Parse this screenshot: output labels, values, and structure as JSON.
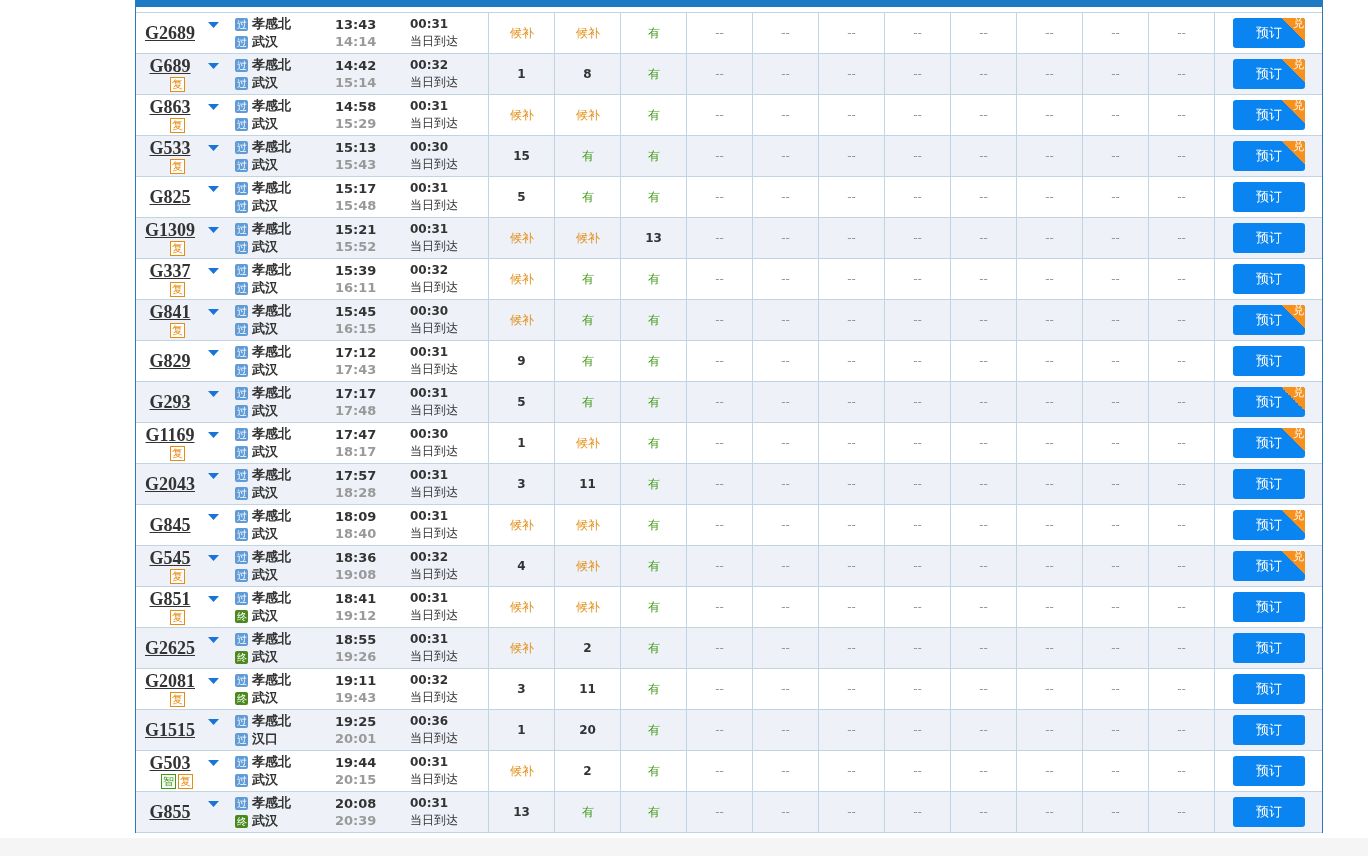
{
  "rows": [
    {
      "train": "G2689",
      "tags": [],
      "from": {
        "mark": "过",
        "kind": "pass",
        "name": "孝感北"
      },
      "to": {
        "mark": "过",
        "kind": "pass",
        "name": "武汉"
      },
      "depart": "13:43",
      "arrive": "14:14",
      "duration": "00:31",
      "arrival_note": "当日到达",
      "seats": [
        {
          "text": "候补",
          "kind": "wait"
        },
        {
          "text": "候补",
          "kind": "wait"
        },
        {
          "text": "有",
          "kind": "avail"
        }
      ],
      "other_seats": [
        "--",
        "--",
        "--",
        "--",
        "--",
        "--",
        "--",
        "--"
      ],
      "button": "预订",
      "badge": "兑"
    },
    {
      "train": "G689",
      "tags": [
        {
          "text": "复",
          "kind": "orange"
        }
      ],
      "from": {
        "mark": "过",
        "kind": "pass",
        "name": "孝感北"
      },
      "to": {
        "mark": "过",
        "kind": "pass",
        "name": "武汉"
      },
      "depart": "14:42",
      "arrive": "15:14",
      "duration": "00:32",
      "arrival_note": "当日到达",
      "seats": [
        {
          "text": "1",
          "kind": "count"
        },
        {
          "text": "8",
          "kind": "count"
        },
        {
          "text": "有",
          "kind": "avail"
        }
      ],
      "other_seats": [
        "--",
        "--",
        "--",
        "--",
        "--",
        "--",
        "--",
        "--"
      ],
      "button": "预订",
      "badge": "兑"
    },
    {
      "train": "G863",
      "tags": [
        {
          "text": "复",
          "kind": "orange"
        }
      ],
      "from": {
        "mark": "过",
        "kind": "pass",
        "name": "孝感北"
      },
      "to": {
        "mark": "过",
        "kind": "pass",
        "name": "武汉"
      },
      "depart": "14:58",
      "arrive": "15:29",
      "duration": "00:31",
      "arrival_note": "当日到达",
      "seats": [
        {
          "text": "候补",
          "kind": "wait"
        },
        {
          "text": "候补",
          "kind": "wait"
        },
        {
          "text": "有",
          "kind": "avail"
        }
      ],
      "other_seats": [
        "--",
        "--",
        "--",
        "--",
        "--",
        "--",
        "--",
        "--"
      ],
      "button": "预订",
      "badge": "兑"
    },
    {
      "train": "G533",
      "tags": [
        {
          "text": "复",
          "kind": "orange"
        }
      ],
      "from": {
        "mark": "过",
        "kind": "pass",
        "name": "孝感北"
      },
      "to": {
        "mark": "过",
        "kind": "pass",
        "name": "武汉"
      },
      "depart": "15:13",
      "arrive": "15:43",
      "duration": "00:30",
      "arrival_note": "当日到达",
      "seats": [
        {
          "text": "15",
          "kind": "count"
        },
        {
          "text": "有",
          "kind": "avail"
        },
        {
          "text": "有",
          "kind": "avail"
        }
      ],
      "other_seats": [
        "--",
        "--",
        "--",
        "--",
        "--",
        "--",
        "--",
        "--"
      ],
      "button": "预订",
      "badge": "兑"
    },
    {
      "train": "G825",
      "tags": [],
      "from": {
        "mark": "过",
        "kind": "pass",
        "name": "孝感北"
      },
      "to": {
        "mark": "过",
        "kind": "pass",
        "name": "武汉"
      },
      "depart": "15:17",
      "arrive": "15:48",
      "duration": "00:31",
      "arrival_note": "当日到达",
      "seats": [
        {
          "text": "5",
          "kind": "count"
        },
        {
          "text": "有",
          "kind": "avail"
        },
        {
          "text": "有",
          "kind": "avail"
        }
      ],
      "other_seats": [
        "--",
        "--",
        "--",
        "--",
        "--",
        "--",
        "--",
        "--"
      ],
      "button": "预订"
    },
    {
      "train": "G1309",
      "tags": [
        {
          "text": "复",
          "kind": "orange"
        }
      ],
      "from": {
        "mark": "过",
        "kind": "pass",
        "name": "孝感北"
      },
      "to": {
        "mark": "过",
        "kind": "pass",
        "name": "武汉"
      },
      "depart": "15:21",
      "arrive": "15:52",
      "duration": "00:31",
      "arrival_note": "当日到达",
      "seats": [
        {
          "text": "候补",
          "kind": "wait"
        },
        {
          "text": "候补",
          "kind": "wait"
        },
        {
          "text": "13",
          "kind": "count"
        }
      ],
      "other_seats": [
        "--",
        "--",
        "--",
        "--",
        "--",
        "--",
        "--",
        "--"
      ],
      "button": "预订"
    },
    {
      "train": "G337",
      "tags": [
        {
          "text": "复",
          "kind": "orange"
        }
      ],
      "from": {
        "mark": "过",
        "kind": "pass",
        "name": "孝感北"
      },
      "to": {
        "mark": "过",
        "kind": "pass",
        "name": "武汉"
      },
      "depart": "15:39",
      "arrive": "16:11",
      "duration": "00:32",
      "arrival_note": "当日到达",
      "seats": [
        {
          "text": "候补",
          "kind": "wait"
        },
        {
          "text": "有",
          "kind": "avail"
        },
        {
          "text": "有",
          "kind": "avail"
        }
      ],
      "other_seats": [
        "--",
        "--",
        "--",
        "--",
        "--",
        "--",
        "--",
        "--"
      ],
      "button": "预订"
    },
    {
      "train": "G841",
      "tags": [
        {
          "text": "复",
          "kind": "orange"
        }
      ],
      "from": {
        "mark": "过",
        "kind": "pass",
        "name": "孝感北"
      },
      "to": {
        "mark": "过",
        "kind": "pass",
        "name": "武汉"
      },
      "depart": "15:45",
      "arrive": "16:15",
      "duration": "00:30",
      "arrival_note": "当日到达",
      "seats": [
        {
          "text": "候补",
          "kind": "wait"
        },
        {
          "text": "有",
          "kind": "avail"
        },
        {
          "text": "有",
          "kind": "avail"
        }
      ],
      "other_seats": [
        "--",
        "--",
        "--",
        "--",
        "--",
        "--",
        "--",
        "--"
      ],
      "button": "预订",
      "badge": "兑"
    },
    {
      "train": "G829",
      "tags": [],
      "from": {
        "mark": "过",
        "kind": "pass",
        "name": "孝感北"
      },
      "to": {
        "mark": "过",
        "kind": "pass",
        "name": "武汉"
      },
      "depart": "17:12",
      "arrive": "17:43",
      "duration": "00:31",
      "arrival_note": "当日到达",
      "seats": [
        {
          "text": "9",
          "kind": "count"
        },
        {
          "text": "有",
          "kind": "avail"
        },
        {
          "text": "有",
          "kind": "avail"
        }
      ],
      "other_seats": [
        "--",
        "--",
        "--",
        "--",
        "--",
        "--",
        "--",
        "--"
      ],
      "button": "预订"
    },
    {
      "train": "G293",
      "tags": [],
      "from": {
        "mark": "过",
        "kind": "pass",
        "name": "孝感北"
      },
      "to": {
        "mark": "过",
        "kind": "pass",
        "name": "武汉"
      },
      "depart": "17:17",
      "arrive": "17:48",
      "duration": "00:31",
      "arrival_note": "当日到达",
      "seats": [
        {
          "text": "5",
          "kind": "count"
        },
        {
          "text": "有",
          "kind": "avail"
        },
        {
          "text": "有",
          "kind": "avail"
        }
      ],
      "other_seats": [
        "--",
        "--",
        "--",
        "--",
        "--",
        "--",
        "--",
        "--"
      ],
      "button": "预订",
      "badge": "兑"
    },
    {
      "train": "G1169",
      "tags": [
        {
          "text": "复",
          "kind": "orange"
        }
      ],
      "from": {
        "mark": "过",
        "kind": "pass",
        "name": "孝感北"
      },
      "to": {
        "mark": "过",
        "kind": "pass",
        "name": "武汉"
      },
      "depart": "17:47",
      "arrive": "18:17",
      "duration": "00:30",
      "arrival_note": "当日到达",
      "seats": [
        {
          "text": "1",
          "kind": "count"
        },
        {
          "text": "候补",
          "kind": "wait"
        },
        {
          "text": "有",
          "kind": "avail"
        }
      ],
      "other_seats": [
        "--",
        "--",
        "--",
        "--",
        "--",
        "--",
        "--",
        "--"
      ],
      "button": "预订",
      "badge": "兑"
    },
    {
      "train": "G2043",
      "tags": [],
      "from": {
        "mark": "过",
        "kind": "pass",
        "name": "孝感北"
      },
      "to": {
        "mark": "过",
        "kind": "pass",
        "name": "武汉"
      },
      "depart": "17:57",
      "arrive": "18:28",
      "duration": "00:31",
      "arrival_note": "当日到达",
      "seats": [
        {
          "text": "3",
          "kind": "count"
        },
        {
          "text": "11",
          "kind": "count"
        },
        {
          "text": "有",
          "kind": "avail"
        }
      ],
      "other_seats": [
        "--",
        "--",
        "--",
        "--",
        "--",
        "--",
        "--",
        "--"
      ],
      "button": "预订"
    },
    {
      "train": "G845",
      "tags": [],
      "from": {
        "mark": "过",
        "kind": "pass",
        "name": "孝感北"
      },
      "to": {
        "mark": "过",
        "kind": "pass",
        "name": "武汉"
      },
      "depart": "18:09",
      "arrive": "18:40",
      "duration": "00:31",
      "arrival_note": "当日到达",
      "seats": [
        {
          "text": "候补",
          "kind": "wait"
        },
        {
          "text": "候补",
          "kind": "wait"
        },
        {
          "text": "有",
          "kind": "avail"
        }
      ],
      "other_seats": [
        "--",
        "--",
        "--",
        "--",
        "--",
        "--",
        "--",
        "--"
      ],
      "button": "预订",
      "badge": "兑"
    },
    {
      "train": "G545",
      "tags": [
        {
          "text": "复",
          "kind": "orange"
        }
      ],
      "from": {
        "mark": "过",
        "kind": "pass",
        "name": "孝感北"
      },
      "to": {
        "mark": "过",
        "kind": "pass",
        "name": "武汉"
      },
      "depart": "18:36",
      "arrive": "19:08",
      "duration": "00:32",
      "arrival_note": "当日到达",
      "seats": [
        {
          "text": "4",
          "kind": "count"
        },
        {
          "text": "候补",
          "kind": "wait"
        },
        {
          "text": "有",
          "kind": "avail"
        }
      ],
      "other_seats": [
        "--",
        "--",
        "--",
        "--",
        "--",
        "--",
        "--",
        "--"
      ],
      "button": "预订",
      "badge": "兑"
    },
    {
      "train": "G851",
      "tags": [
        {
          "text": "复",
          "kind": "orange"
        }
      ],
      "from": {
        "mark": "过",
        "kind": "pass",
        "name": "孝感北"
      },
      "to": {
        "mark": "终",
        "kind": "end",
        "name": "武汉"
      },
      "depart": "18:41",
      "arrive": "19:12",
      "duration": "00:31",
      "arrival_note": "当日到达",
      "seats": [
        {
          "text": "候补",
          "kind": "wait"
        },
        {
          "text": "候补",
          "kind": "wait"
        },
        {
          "text": "有",
          "kind": "avail"
        }
      ],
      "other_seats": [
        "--",
        "--",
        "--",
        "--",
        "--",
        "--",
        "--",
        "--"
      ],
      "button": "预订"
    },
    {
      "train": "G2625",
      "tags": [],
      "from": {
        "mark": "过",
        "kind": "pass",
        "name": "孝感北"
      },
      "to": {
        "mark": "终",
        "kind": "end",
        "name": "武汉"
      },
      "depart": "18:55",
      "arrive": "19:26",
      "duration": "00:31",
      "arrival_note": "当日到达",
      "seats": [
        {
          "text": "候补",
          "kind": "wait"
        },
        {
          "text": "2",
          "kind": "count"
        },
        {
          "text": "有",
          "kind": "avail"
        }
      ],
      "other_seats": [
        "--",
        "--",
        "--",
        "--",
        "--",
        "--",
        "--",
        "--"
      ],
      "button": "预订"
    },
    {
      "train": "G2081",
      "tags": [
        {
          "text": "复",
          "kind": "orange"
        }
      ],
      "from": {
        "mark": "过",
        "kind": "pass",
        "name": "孝感北"
      },
      "to": {
        "mark": "终",
        "kind": "end",
        "name": "武汉"
      },
      "depart": "19:11",
      "arrive": "19:43",
      "duration": "00:32",
      "arrival_note": "当日到达",
      "seats": [
        {
          "text": "3",
          "kind": "count"
        },
        {
          "text": "11",
          "kind": "count"
        },
        {
          "text": "有",
          "kind": "avail"
        }
      ],
      "other_seats": [
        "--",
        "--",
        "--",
        "--",
        "--",
        "--",
        "--",
        "--"
      ],
      "button": "预订"
    },
    {
      "train": "G1515",
      "tags": [],
      "from": {
        "mark": "过",
        "kind": "pass",
        "name": "孝感北"
      },
      "to": {
        "mark": "过",
        "kind": "pass",
        "name": "汉口"
      },
      "depart": "19:25",
      "arrive": "20:01",
      "duration": "00:36",
      "arrival_note": "当日到达",
      "seats": [
        {
          "text": "1",
          "kind": "count"
        },
        {
          "text": "20",
          "kind": "count"
        },
        {
          "text": "有",
          "kind": "avail"
        }
      ],
      "other_seats": [
        "--",
        "--",
        "--",
        "--",
        "--",
        "--",
        "--",
        "--"
      ],
      "button": "预订"
    },
    {
      "train": "G503",
      "tags": [
        {
          "text": "智",
          "kind": "green"
        },
        {
          "text": "复",
          "kind": "orange"
        }
      ],
      "from": {
        "mark": "过",
        "kind": "pass",
        "name": "孝感北"
      },
      "to": {
        "mark": "过",
        "kind": "pass",
        "name": "武汉"
      },
      "depart": "19:44",
      "arrive": "20:15",
      "duration": "00:31",
      "arrival_note": "当日到达",
      "seats": [
        {
          "text": "候补",
          "kind": "wait"
        },
        {
          "text": "2",
          "kind": "count"
        },
        {
          "text": "有",
          "kind": "avail"
        }
      ],
      "other_seats": [
        "--",
        "--",
        "--",
        "--",
        "--",
        "--",
        "--",
        "--"
      ],
      "button": "预订"
    },
    {
      "train": "G855",
      "tags": [],
      "from": {
        "mark": "过",
        "kind": "pass",
        "name": "孝感北"
      },
      "to": {
        "mark": "终",
        "kind": "end",
        "name": "武汉"
      },
      "depart": "20:08",
      "arrive": "20:39",
      "duration": "00:31",
      "arrival_note": "当日到达",
      "seats": [
        {
          "text": "13",
          "kind": "count"
        },
        {
          "text": "有",
          "kind": "avail"
        },
        {
          "text": "有",
          "kind": "avail"
        }
      ],
      "other_seats": [
        "--",
        "--",
        "--",
        "--",
        "--",
        "--",
        "--",
        "--"
      ],
      "button": "预订"
    }
  ]
}
